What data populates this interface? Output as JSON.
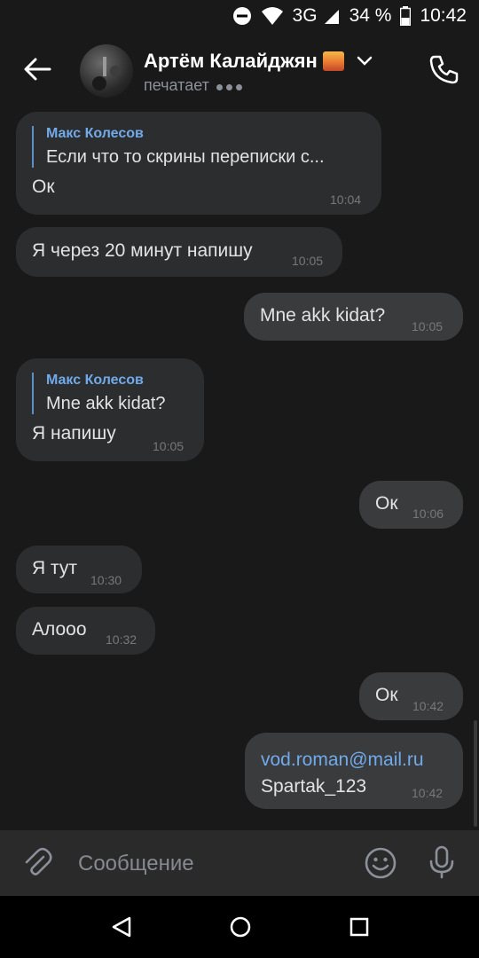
{
  "status_bar": {
    "network": "3G",
    "battery": "34 %",
    "time": "10:42"
  },
  "header": {
    "contact_name": "Артём Калайджян",
    "status": "печатает"
  },
  "messages": [
    {
      "dir": "in",
      "reply_author": "Макс Колесов",
      "reply_text": "Если что то скрины переписки с...",
      "text": "Ок",
      "time": "10:04"
    },
    {
      "dir": "in",
      "text": "Я через 20 минут напишу",
      "time": "10:05"
    },
    {
      "dir": "out",
      "text": "Mne akk kidat?",
      "time": "10:05"
    },
    {
      "dir": "in",
      "reply_author": "Макс Колесов",
      "reply_text": "Mne akk kidat?",
      "text": "Я напишу",
      "time": "10:05"
    },
    {
      "dir": "out",
      "text": "Ок",
      "time": "10:06"
    },
    {
      "dir": "in",
      "text": "Я тут",
      "time": "10:30"
    },
    {
      "dir": "in",
      "text": "Алооо",
      "time": "10:32"
    },
    {
      "dir": "out",
      "text": "Ок",
      "time": "10:42"
    },
    {
      "dir": "out",
      "link": "vod.roman@mail.ru",
      "text": "Spartak_123",
      "time": "10:42"
    }
  ],
  "composer": {
    "placeholder": "Сообщение"
  },
  "icons": {
    "back": "arrow-left-icon",
    "call": "phone-icon",
    "attach": "paperclip-icon",
    "emoji": "smile-icon",
    "voice": "microphone-icon"
  },
  "colors": {
    "background": "#19191a",
    "bubble_in": "#2c2d2e",
    "bubble_out": "#3a3b3d",
    "link": "#71aaeb",
    "composer": "#2a2a2b"
  }
}
